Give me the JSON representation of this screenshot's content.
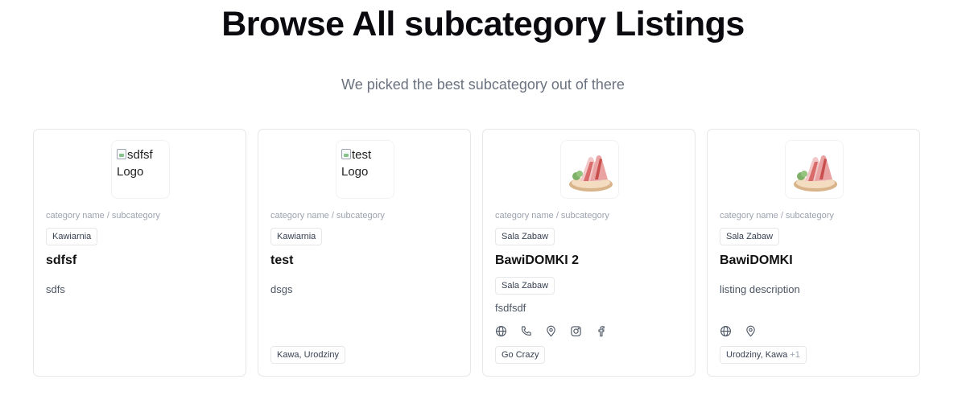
{
  "header": {
    "title": "Browse All subcategory Listings",
    "subtitle": "We picked the best subcategory out of there"
  },
  "listings": [
    {
      "logo_alt": "sdfsf",
      "logo_alt_suffix": "Logo",
      "breadcrumb": "category name / subcategory",
      "category_tag": "Kawiarnia",
      "title": "sdfsf",
      "description": "sdfs"
    },
    {
      "logo_alt": "test",
      "logo_alt_suffix": "Logo",
      "breadcrumb": "category name / subcategory",
      "category_tag": "Kawiarnia",
      "title": "test",
      "description": "dsgs",
      "bottom_tag": "Kawa, Urodziny"
    },
    {
      "logo_image": "slide-icon",
      "breadcrumb": "category name / subcategory",
      "category_tag": "Sala Zabaw",
      "title": "BawiDOMKI 2",
      "extra_tag": "Sala Zabaw",
      "description": "fsdfsdf",
      "links": [
        "globe-icon",
        "phone-icon",
        "map-pin-icon",
        "instagram-icon",
        "facebook-icon"
      ],
      "bottom_tag": "Go Crazy"
    },
    {
      "logo_image": "slide-icon",
      "breadcrumb": "category name / subcategory",
      "category_tag": "Sala Zabaw",
      "title": "BawiDOMKI",
      "description": "listing description",
      "links": [
        "globe-icon",
        "map-pin-icon"
      ],
      "bottom_tag": "Urodziny, Kawa",
      "bottom_tag_more": "+1"
    }
  ]
}
